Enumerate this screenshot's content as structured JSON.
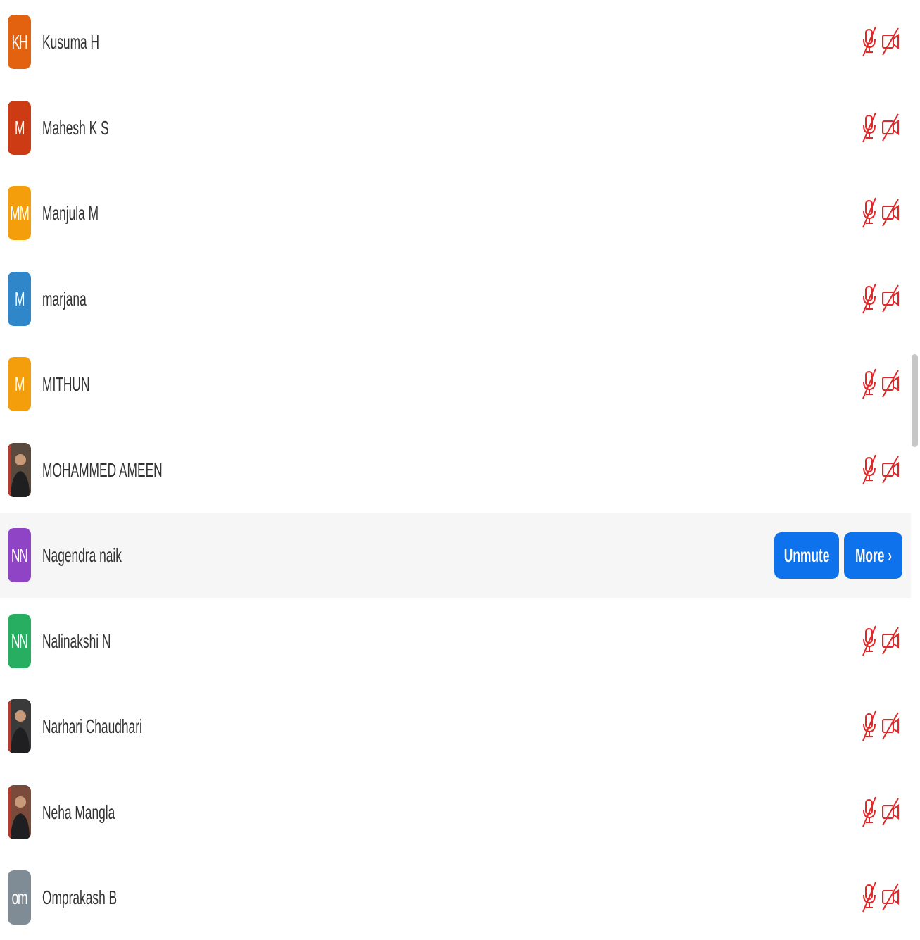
{
  "participants": [
    {
      "name": "Kusuma H",
      "initials": "KH",
      "avatar_color": "#e2620f",
      "photo": false
    },
    {
      "name": "Mahesh K S",
      "initials": "M",
      "avatar_color": "#cc3b14",
      "photo": false
    },
    {
      "name": "Manjula M",
      "initials": "MM",
      "avatar_color": "#f59e0b",
      "photo": false
    },
    {
      "name": "marjana",
      "initials": "M",
      "avatar_color": "#2f86c9",
      "photo": false
    },
    {
      "name": "MITHUN",
      "initials": "M",
      "avatar_color": "#f59e0b",
      "photo": false
    },
    {
      "name": "MOHAMMED AMEEN",
      "initials": "",
      "avatar_color": "#5a4a3e",
      "photo": true
    },
    {
      "name": "Nagendra naik",
      "initials": "NN",
      "avatar_color": "#8e44c4",
      "photo": false,
      "hovered": true
    },
    {
      "name": "Nalinakshi N",
      "initials": "NN",
      "avatar_color": "#27ae60",
      "photo": false
    },
    {
      "name": "Narhari Chaudhari",
      "initials": "",
      "avatar_color": "#3a3a3a",
      "photo": true
    },
    {
      "name": "Neha Mangla",
      "initials": "",
      "avatar_color": "#7a4b3a",
      "photo": true
    },
    {
      "name": "Omprakash B",
      "initials": "om",
      "avatar_color": "#7f8c95",
      "photo": false
    }
  ],
  "hover_actions": {
    "unmute_label": "Unmute",
    "more_label": "More ›",
    "button_color": "#0e72ed"
  },
  "icons": {
    "mic": "mic-muted-icon",
    "video": "video-off-icon",
    "status_color": "#e02828"
  }
}
